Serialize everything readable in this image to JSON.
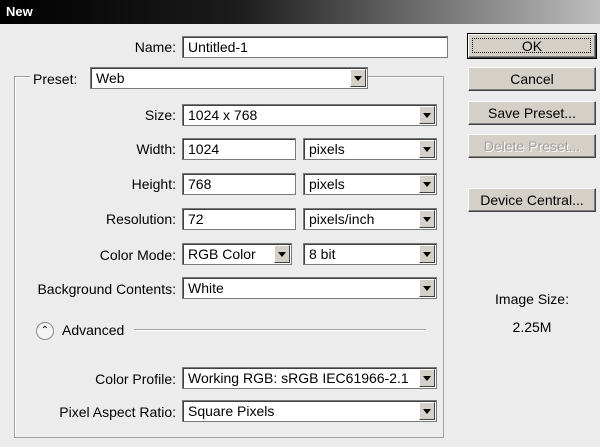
{
  "window": {
    "title": "New"
  },
  "form": {
    "name": {
      "label": "Name:",
      "value": "Untitled-1"
    },
    "preset": {
      "label": "Preset:",
      "value": "Web"
    },
    "size": {
      "label": "Size:",
      "value": "1024 x 768"
    },
    "width": {
      "label": "Width:",
      "value": "1024",
      "unit": "pixels"
    },
    "height": {
      "label": "Height:",
      "value": "768",
      "unit": "pixels"
    },
    "resolution": {
      "label": "Resolution:",
      "value": "72",
      "unit": "pixels/inch"
    },
    "color_mode": {
      "label": "Color Mode:",
      "value": "RGB Color",
      "depth": "8 bit"
    },
    "background_contents": {
      "label": "Background Contents:",
      "value": "White"
    },
    "advanced": {
      "label": "Advanced",
      "toggle_glyph": "⌃"
    },
    "color_profile": {
      "label": "Color Profile:",
      "value": "Working RGB:  sRGB IEC61966-2.1"
    },
    "pixel_aspect_ratio": {
      "label": "Pixel Aspect Ratio:",
      "value": "Square Pixels"
    }
  },
  "buttons": {
    "ok": "OK",
    "cancel": "Cancel",
    "save_preset": "Save Preset...",
    "delete_preset": "Delete Preset...",
    "device_central": "Device Central..."
  },
  "info": {
    "image_size_label": "Image Size:",
    "image_size_value": "2.25M"
  }
}
